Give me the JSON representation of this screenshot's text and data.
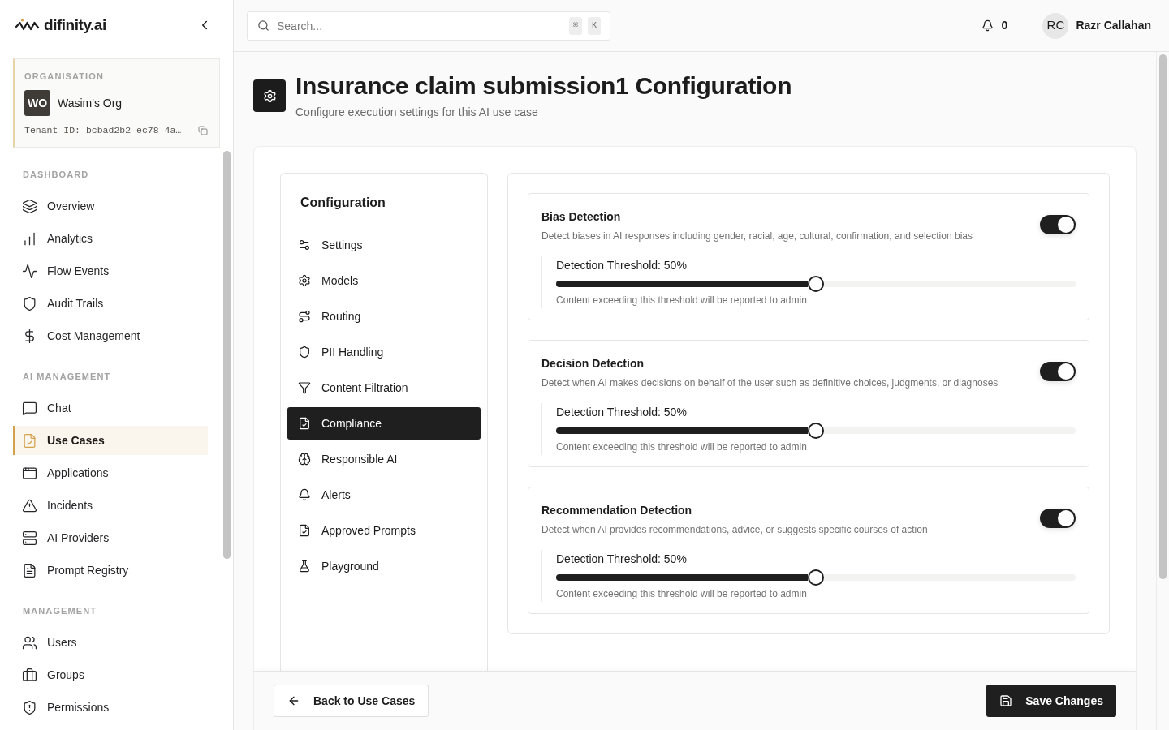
{
  "sidebar": {
    "brand": "difinity.ai",
    "organisation": {
      "label": "ORGANISATION",
      "initials": "WO",
      "name": "Wasim's Org",
      "tenant_id": "Tenant ID: bcbad2b2-ec78-4a…"
    },
    "sections": [
      {
        "title": "DASHBOARD",
        "items": [
          {
            "label": "Overview",
            "selected": false
          },
          {
            "label": "Analytics",
            "selected": false
          },
          {
            "label": "Flow Events",
            "selected": false
          },
          {
            "label": "Audit Trails",
            "selected": false
          },
          {
            "label": "Cost Management",
            "selected": false
          }
        ]
      },
      {
        "title": "AI MANAGEMENT",
        "items": [
          {
            "label": "Chat",
            "selected": false
          },
          {
            "label": "Use Cases",
            "selected": true
          },
          {
            "label": "Applications",
            "selected": false
          },
          {
            "label": "Incidents",
            "selected": false
          },
          {
            "label": "AI Providers",
            "selected": false
          },
          {
            "label": "Prompt Registry",
            "selected": false
          }
        ]
      },
      {
        "title": "MANAGEMENT",
        "items": [
          {
            "label": "Users",
            "selected": false
          },
          {
            "label": "Groups",
            "selected": false
          },
          {
            "label": "Permissions",
            "selected": false
          }
        ]
      }
    ]
  },
  "header": {
    "search": {
      "placeholder": "Search...",
      "shortcut": [
        "⌘",
        "K"
      ]
    },
    "notifications": "0",
    "user": {
      "initials": "RC",
      "name": "Razr Callahan"
    }
  },
  "page": {
    "title": "Insurance claim submission1 Configuration",
    "subtitle": "Configure execution settings for this AI use case"
  },
  "config_nav": {
    "title": "Configuration",
    "items": [
      {
        "label": "Settings",
        "selected": false
      },
      {
        "label": "Models",
        "selected": false
      },
      {
        "label": "Routing",
        "selected": false
      },
      {
        "label": "PII Handling",
        "selected": false
      },
      {
        "label": "Content Filtration",
        "selected": false
      },
      {
        "label": "Compliance",
        "selected": true
      },
      {
        "label": "Responsible AI",
        "selected": false
      },
      {
        "label": "Alerts",
        "selected": false
      },
      {
        "label": "Approved Prompts",
        "selected": false
      },
      {
        "label": "Playground",
        "selected": false
      }
    ]
  },
  "detections": [
    {
      "title": "Bias Detection",
      "description": "Detect biases in AI responses including gender, racial, age, cultural, confirmation, and selection bias",
      "on": true,
      "threshold_label": "Detection Threshold: 50%",
      "level": 0.5,
      "note": "Content exceeding this threshold will be reported to admin"
    },
    {
      "title": "Decision Detection",
      "description": "Detect when AI makes decisions on behalf of the user such as definitive choices, judgments, or diagnoses",
      "on": true,
      "threshold_label": "Detection Threshold: 50%",
      "level": 0.5,
      "note": "Content exceeding this threshold will be reported to admin"
    },
    {
      "title": "Recommendation Detection",
      "description": "Detect when AI provides recommendations, advice, or suggests specific courses of action",
      "on": true,
      "threshold_label": "Detection Threshold: 50%",
      "level": 0.5,
      "note": "Content exceeding this threshold will be reported to admin"
    }
  ],
  "footer": {
    "back_button": "Back to Use Cases",
    "save_button": "Save Changes"
  }
}
